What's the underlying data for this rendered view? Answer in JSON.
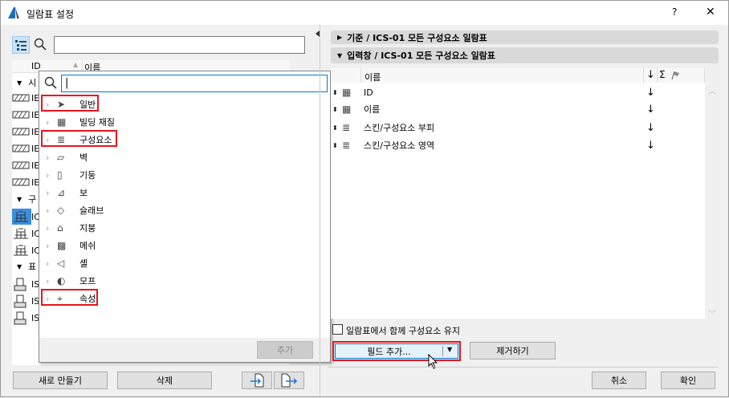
{
  "window": {
    "title": "일람표 설정",
    "help": "?",
    "close": "✕"
  },
  "left": {
    "search_value": "",
    "columns": {
      "id": "ID",
      "name": "이름"
    },
    "groups": [
      {
        "label": "시",
        "rows": [
          "IE",
          "IE",
          "IE",
          "IE",
          "IE",
          "IE"
        ]
      },
      {
        "label": "구",
        "rows": [
          "IC",
          "IC",
          "IC"
        ]
      },
      {
        "label": "표",
        "rows": [
          "IS",
          "IS",
          "IS"
        ]
      }
    ],
    "new_button": "새로 만들기",
    "delete_button": "삭제"
  },
  "popup": {
    "search_value": "|",
    "items": [
      "일반",
      "빌딩 재질",
      "구성요소",
      "벽",
      "기둥",
      "보",
      "슬래브",
      "지붕",
      "메쉬",
      "셸",
      "모프",
      "속성"
    ],
    "add_button": "추가"
  },
  "right": {
    "section1": "기준 / ICS-01 모든 구성요소 일람표",
    "section2": "입력창 / ICS-01 모든 구성요소 일람표",
    "table_header": {
      "name": "이름",
      "sort": "↓",
      "sum": "Σ"
    },
    "rows": [
      {
        "name": "ID",
        "sort": "↓"
      },
      {
        "name": "이름",
        "sort": "↓"
      },
      {
        "name": "스킨/구성요소 부피",
        "sort": "↓"
      },
      {
        "name": "스킨/구성요소 영역",
        "sort": "↓"
      }
    ],
    "keep_checkbox": "일람표에서 함께 구성요소 유지",
    "add_field_button": "필드 추가...",
    "remove_button": "제거하기",
    "cancel_button": "취소",
    "ok_button": "확인"
  },
  "colors": {
    "highlight": "#e8141a",
    "accent": "#0078d7"
  }
}
